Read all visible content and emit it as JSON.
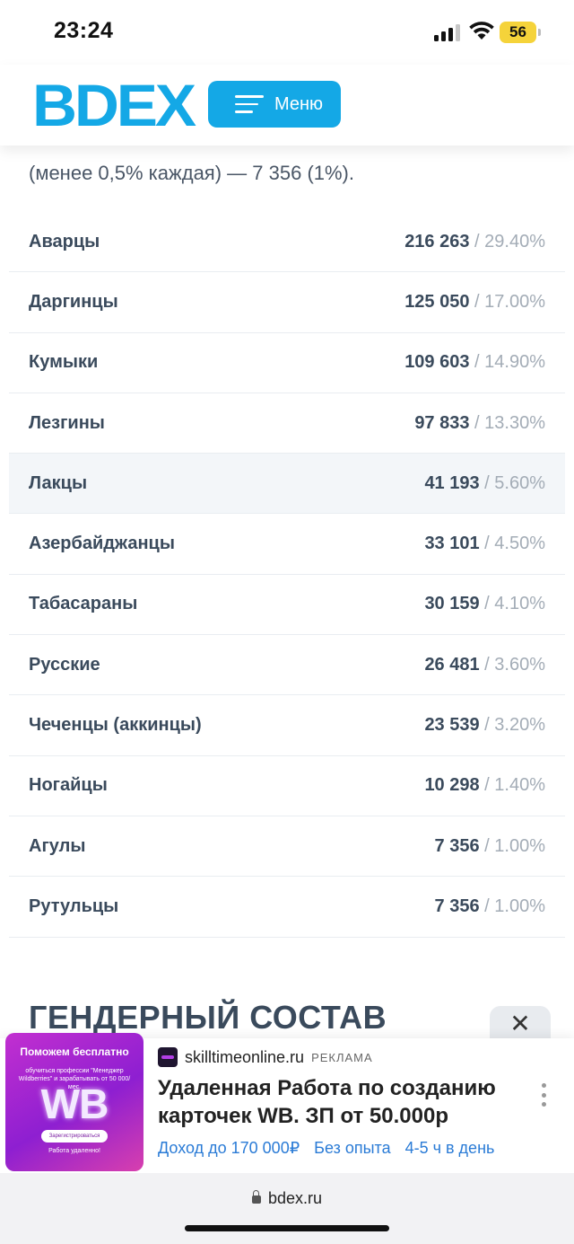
{
  "status": {
    "time": "23:24",
    "battery": "56"
  },
  "header": {
    "logo": "BDEX",
    "menu_label": "Меню"
  },
  "intro_text": "(менее 0,5% каждая) — 7 356 (1%).",
  "table": [
    {
      "name": "Аварцы",
      "value": "216 263",
      "percent": "29.40%"
    },
    {
      "name": "Даргинцы",
      "value": "125 050",
      "percent": "17.00%"
    },
    {
      "name": "Кумыки",
      "value": "109 603",
      "percent": "14.90%"
    },
    {
      "name": "Лезгины",
      "value": "97 833",
      "percent": "13.30%"
    },
    {
      "name": "Лакцы",
      "value": "41 193",
      "percent": "5.60%"
    },
    {
      "name": "Азербайджанцы",
      "value": "33 101",
      "percent": "4.50%"
    },
    {
      "name": "Табасараны",
      "value": "30 159",
      "percent": "4.10%"
    },
    {
      "name": "Русские",
      "value": "26 481",
      "percent": "3.60%"
    },
    {
      "name": "Чеченцы (аккинцы)",
      "value": "23 539",
      "percent": "3.20%"
    },
    {
      "name": "Ногайцы",
      "value": "10 298",
      "percent": "1.40%"
    },
    {
      "name": "Агулы",
      "value": "7 356",
      "percent": "1.00%"
    },
    {
      "name": "Рутульцы",
      "value": "7 356",
      "percent": "1.00%"
    }
  ],
  "section_title": "ГЕНДЕРНЫЙ СОСТАВ",
  "ad": {
    "close_symbol": "✕",
    "image": {
      "headline": "Поможем бесплатно",
      "subtext": "обучиться профессии \"Менеджер Wildberries\" и зарабатывать от 50 000/мес.",
      "logo_text": "WB",
      "button": "Зарегистрироваться",
      "footer": "Работа удаленно!"
    },
    "domain": "skilltimeonline.ru",
    "tag": "РЕКЛАМА",
    "title": "Удаленная Работа по созданию карточек WB. ЗП от 50.000р",
    "links": [
      "Доход до 170 000₽",
      "Без опыта",
      "4-5 ч в день"
    ]
  },
  "browser": {
    "url": "bdex.ru"
  }
}
